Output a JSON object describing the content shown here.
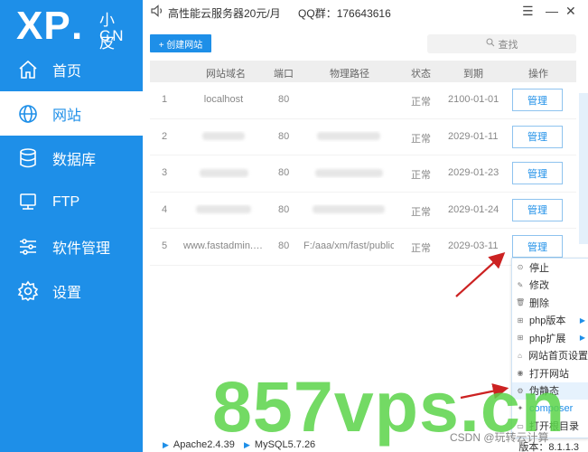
{
  "brand": {
    "logo_main": "XP",
    "logo_dot": ".",
    "logo_cn_top": "小皮",
    "logo_cn_bottom": "CN"
  },
  "topbar": {
    "notice": "高性能云服务器20元/月",
    "qq": "QQ群：176643616"
  },
  "window_controls": {
    "menu": "☰",
    "minimize": "—",
    "close": "✕"
  },
  "nav": [
    {
      "label": "首页",
      "icon": "home-icon",
      "active": false
    },
    {
      "label": "网站",
      "icon": "globe-icon",
      "active": true
    },
    {
      "label": "数据库",
      "icon": "database-icon",
      "active": false
    },
    {
      "label": "FTP",
      "icon": "ftp-icon",
      "active": false
    },
    {
      "label": "软件管理",
      "icon": "sliders-icon",
      "active": false
    },
    {
      "label": "设置",
      "icon": "gear-icon",
      "active": false
    }
  ],
  "toolbar": {
    "create_label": "+ 创建网站",
    "search_placeholder": "查找"
  },
  "table": {
    "headers": [
      "网站域名",
      "端口",
      "物理路径",
      "状态",
      "到期",
      "操作"
    ],
    "rows": [
      {
        "index": "1",
        "domain": "localhost",
        "port": "80",
        "path": "",
        "status": "正常",
        "expiry": "2100-01-01",
        "action": "管理",
        "blur": false
      },
      {
        "index": "2",
        "domain": "",
        "port": "80",
        "path": "",
        "status": "正常",
        "expiry": "2029-01-11",
        "action": "管理",
        "blur": true
      },
      {
        "index": "3",
        "domain": "",
        "port": "80",
        "path": "",
        "status": "正常",
        "expiry": "2029-01-23",
        "action": "管理",
        "blur": true
      },
      {
        "index": "4",
        "domain": "",
        "port": "80",
        "path": "",
        "status": "正常",
        "expiry": "2029-01-24",
        "action": "管理",
        "blur": true
      },
      {
        "index": "5",
        "domain": "www.fastadmin.c...",
        "port": "80",
        "path": "F:/aaa/xm/fast/public",
        "status": "正常",
        "expiry": "2029-03-11",
        "action": "管理",
        "blur": false
      }
    ]
  },
  "context_menu": [
    {
      "label": "停止",
      "icon": "stop-icon",
      "submenu": false,
      "highlight": false,
      "blue": false
    },
    {
      "label": "修改",
      "icon": "edit-icon",
      "submenu": false,
      "highlight": false,
      "blue": false
    },
    {
      "label": "删除",
      "icon": "trash-icon",
      "submenu": false,
      "highlight": false,
      "blue": false
    },
    {
      "label": "php版本",
      "icon": "php-icon",
      "submenu": true,
      "highlight": false,
      "blue": false
    },
    {
      "label": "php扩展",
      "icon": "php-ext-icon",
      "submenu": true,
      "highlight": false,
      "blue": false
    },
    {
      "label": "网站首页设置",
      "icon": "home-setting-icon",
      "submenu": false,
      "highlight": false,
      "blue": false
    },
    {
      "label": "打开网站",
      "icon": "open-site-icon",
      "submenu": false,
      "highlight": false,
      "blue": false
    },
    {
      "label": "伪静态",
      "icon": "rewrite-icon",
      "submenu": false,
      "highlight": true,
      "blue": false
    },
    {
      "label": "composer",
      "icon": "composer-icon",
      "submenu": false,
      "highlight": false,
      "blue": true
    },
    {
      "label": "打开根目录",
      "icon": "folder-icon",
      "submenu": false,
      "highlight": false,
      "blue": false
    }
  ],
  "statusbar": {
    "services": [
      "Apache2.4.39",
      "MySQL5.7.26"
    ],
    "version": "版本：8.1.1.3"
  },
  "watermarks": {
    "site": "857vps.cn",
    "csdn": "CSDN @玩转云计算"
  },
  "colors": {
    "brand_blue": "#1e8fe8",
    "sidebar_bg": "#1e8fe8",
    "menu_highlight": "#e6f2fd",
    "annotation_red": "#cc2222",
    "watermark_green": "#5bd44a"
  }
}
